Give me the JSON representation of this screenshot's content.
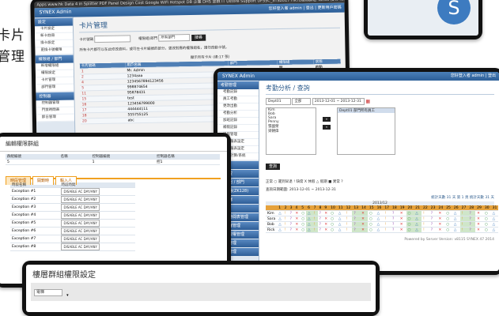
{
  "side_text": [
    "卡片",
    "管理"
  ],
  "browser_bar": "Apps  www.hk  Data 4 in Splitter PDF  Panel Design Cost  Google  WiFi Hotspot  DB 企業  DHS 金融  IT Ustore Support  UFSSC_STS2017  HK代理商群組  Yahoo 搜尋  Tonsel 智能電腦",
  "card_window": {
    "app_title": "SYNEX Admin",
    "user_info": "您好登入者 admin | 登出 | 更新用戶密碼",
    "menu_heading": "設定",
    "menu_items": [
      "卡片設定",
      "新卡註冊",
      "換卡設定",
      "更換卡號權限"
    ],
    "menu_heading2": "權限組 / 部門",
    "menu_items2": [
      "新增權限組",
      "權限設定",
      "卡片管理",
      "部門管理"
    ],
    "menu_heading3": "控制器",
    "menu_items3": [
      "控制器管理",
      "門禁時間表",
      "節日管理"
    ],
    "page_title": "卡片管理",
    "filter_label1": "卡片號碼",
    "filter_label2": "權限組/部門",
    "filter_select": "所有部門",
    "search_button": "搜尋",
    "note": "所有卡片都可以在此修改資料，或可在卡片編號的部分，更改對應的權限組名，請勿改動卡號。",
    "list_header": "顯示所有卡片 (總:17 張)",
    "columns": [
      "卡片號碼",
      "用戶名稱",
      "部門",
      "權限組",
      "狀態"
    ],
    "rows": [
      [
        "1",
        "Mr. Admin",
        "--",
        "開",
        "啟動"
      ],
      [
        "2",
        "1234aaa",
        "IT",
        "第二組",
        "啟動"
      ],
      [
        "4",
        "1234567894123456",
        "IT",
        "第1組",
        "啟動"
      ],
      [
        "5",
        "998874654",
        "email",
        "第1組",
        "啟動"
      ],
      [
        "11",
        "95878431",
        "cardcard",
        "第1組",
        "啟動"
      ],
      [
        "15",
        "test",
        "test",
        "第1組",
        "啟動"
      ],
      [
        "16",
        "123456789000",
        "test3",
        "第1組",
        "啟動"
      ],
      [
        "17",
        "444444111",
        "test",
        "第1組",
        "啟動"
      ],
      [
        "18",
        "555755125",
        "test",
        "第1組",
        "啟動"
      ],
      [
        "20",
        "abc",
        "test",
        "第1組",
        "啟動"
      ]
    ]
  },
  "attendance_window": {
    "app_title": "SYNEX Admin",
    "user_info": "您好登入者 admin | 登出",
    "menu_heading": "考勤管理",
    "menu_items": [
      "考勤記錄",
      "員工考勤",
      "更改出勤",
      "考勤分析",
      "加班記錄",
      "補假記錄",
      "請假管理",
      "考勤報表設定",
      "考勤報表設定",
      "考勤計算/系統"
    ],
    "menu_groups": [
      "報告",
      "總監控",
      "權限組 / 部門",
      "控制器(ZK128)",
      "控制器",
      "門禁",
      "門禁時間表管理",
      "控制器管理",
      "前端授權管理",
      "員工管理",
      "系統管理"
    ],
    "page_title": "考勤分析 / 查詢",
    "dept_select": "Dept01",
    "status_select": "全部",
    "date_range": "2013-12-01 ~ 2013-12-31",
    "employees": [
      "Kim",
      "Bob",
      "Sara",
      "Penny",
      "張國榮",
      "梁朝偉"
    ],
    "selected_emp": "Dept01 部門所有員工",
    "query_button": "查詢",
    "legend": "正常 ○ 遲到早退 ! 缺席 X 休假 △ 假期 ■ 異常 ?",
    "period_label": "查詢日期範圍: 2013-12-01 ~ 2013-12-31",
    "summary": "統計天數 31 天  第 1 頁  統計天數 31 天",
    "month": "2013/12",
    "emp_rows": [
      "Kim",
      "Sara",
      "Bob",
      "Rick"
    ],
    "footer": "Powered by Server Version: v8115 SYNEX 47 2014"
  },
  "group_window": {
    "title": "編輯權限群組",
    "header_cols": [
      "群組編號",
      "名稱",
      "控制器編號",
      "控制器名稱"
    ],
    "header_vals": [
      "5",
      "",
      "1",
      "控1"
    ],
    "tabs": [
      "時段管理",
      "開鎖時",
      "輸入人"
    ],
    "col1": "時段名稱",
    "col2": "時段時間",
    "rows": [
      [
        "Exception #1",
        "DISABLE AC DAY/ANY"
      ],
      [
        "Exception #2",
        "DISABLE AC DAY/ANY"
      ],
      [
        "Exception #3",
        "DISABLE AC DAY/ANY"
      ],
      [
        "Exception #4",
        "DISABLE AC DAY/ANY"
      ],
      [
        "Exception #5",
        "DISABLE AC DAY/ANY"
      ],
      [
        "Exception #6",
        "DISABLE AC DAY/ANY"
      ],
      [
        "Exception #7",
        "DISABLE AC DAY/ANY"
      ],
      [
        "Exception #8",
        "DISABLE AC DAY/ANY"
      ]
    ]
  },
  "floor_window": {
    "title": "樓層群組權限設定",
    "select": "電梯"
  }
}
